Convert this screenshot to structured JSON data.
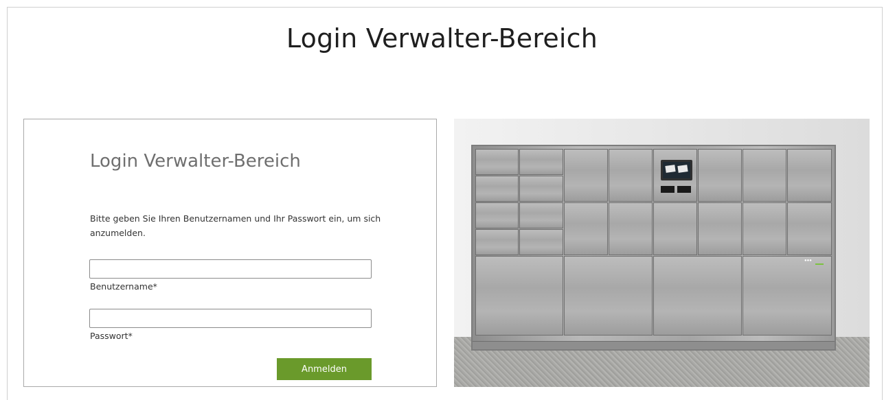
{
  "page": {
    "title": "Login Verwalter-Bereich"
  },
  "login_form": {
    "title": "Login Verwalter-Bereich",
    "description": "Bitte geben Sie Ihren Benutzernamen und Ihr Passwort ein, um sich anzumelden.",
    "username": {
      "label": "Benutzername*",
      "value": ""
    },
    "password": {
      "label": "Passwort*",
      "value": ""
    },
    "submit_label": "Anmelden",
    "accent_color": "#6a9a2b"
  },
  "product_photo": {
    "subject": "stainless-steel parcel locker station"
  }
}
